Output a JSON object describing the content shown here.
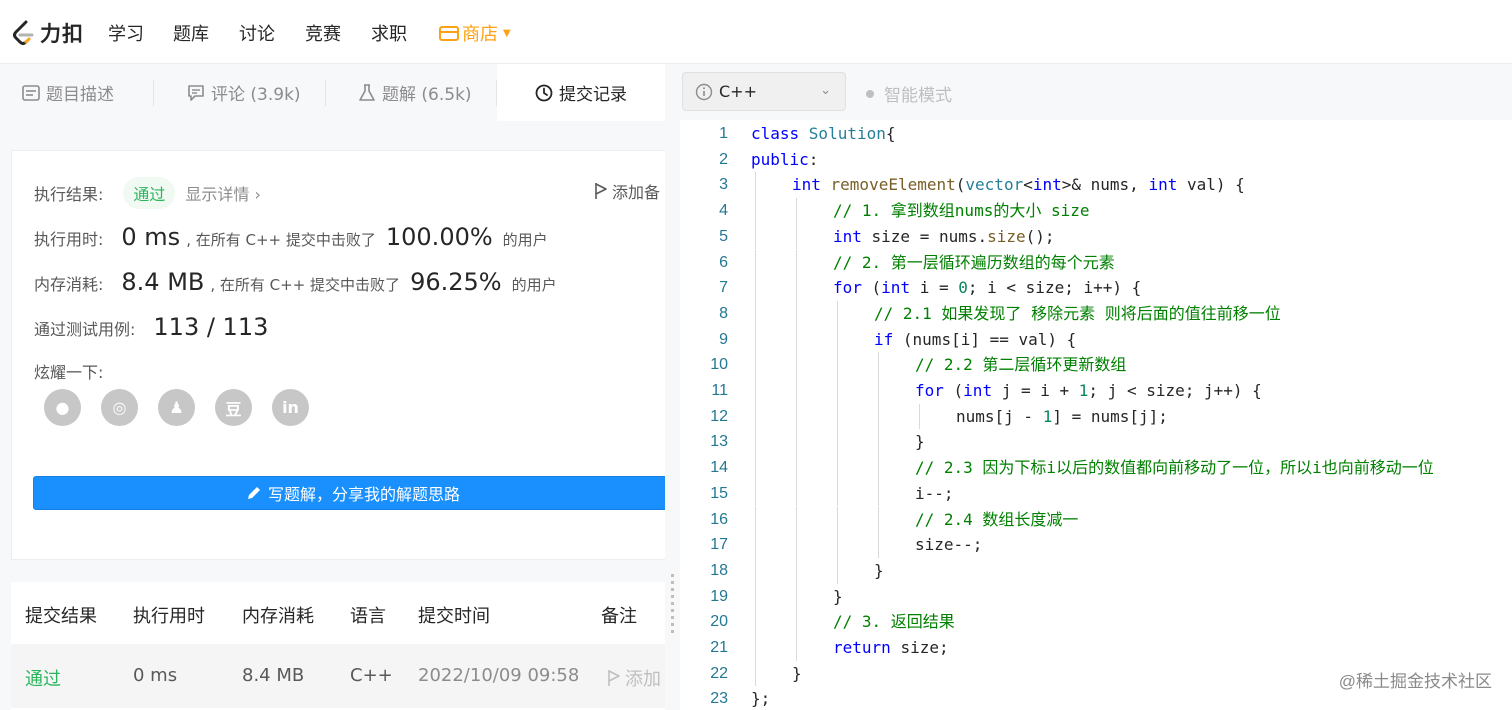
{
  "nav": {
    "logo_text": "力扣",
    "items": [
      "学习",
      "题库",
      "讨论",
      "竞赛",
      "求职"
    ],
    "store_label": "商店",
    "store_color": "#ffa116"
  },
  "tabs": [
    {
      "label": "题目描述",
      "icon": "description-icon"
    },
    {
      "label": "评论 (3.9k)",
      "icon": "comment-icon"
    },
    {
      "label": "题解 (6.5k)",
      "icon": "flask-icon"
    },
    {
      "label": "提交记录",
      "icon": "clock-icon"
    }
  ],
  "result": {
    "status_label": "执行结果:",
    "status_value": "通过",
    "detail_link": "显示详情 ›",
    "add_note": "添加备",
    "runtime_label": "执行用时:",
    "runtime_value": "0 ms",
    "runtime_text": ", 在所有 C++ 提交中击败了",
    "runtime_pct": "100.00%",
    "users_text": "的用户",
    "memory_label": "内存消耗:",
    "memory_value": "8.4 MB",
    "memory_text": ", 在所有 C++ 提交中击败了",
    "memory_pct": "96.25%",
    "testcase_label": "通过测试用例:",
    "testcase_value": "113 / 113",
    "share_label": "炫耀一下:",
    "share_icons": [
      "wechat-icon",
      "weibo-icon",
      "qq-icon",
      "douban-icon",
      "linkedin-icon"
    ],
    "share_glyphs": [
      "●",
      "◎",
      "♟",
      "豆",
      "in"
    ],
    "write_button": "写题解，分享我的解题思路",
    "success_color": "#2db55d",
    "button_color": "#1a90ff"
  },
  "submissions": {
    "headers": [
      "提交结果",
      "执行用时",
      "内存消耗",
      "语言",
      "提交时间",
      "备注"
    ],
    "rows": [
      {
        "result": "通过",
        "runtime": "0 ms",
        "memory": "8.4 MB",
        "lang": "C++",
        "time": "2022/10/09 09:58",
        "note": "添加"
      }
    ]
  },
  "editor": {
    "language": "C++",
    "smart_mode": "智能模式",
    "lines": [
      {
        "n": "1",
        "indent": 0,
        "tokens": [
          [
            "kw",
            "class "
          ],
          [
            "cls",
            "Solution"
          ],
          [
            "",
            "{"
          ]
        ]
      },
      {
        "n": "2",
        "indent": 0,
        "tokens": [
          [
            "kw",
            "public"
          ],
          [
            "",
            ":"
          ]
        ]
      },
      {
        "n": "3",
        "indent": 1,
        "tokens": [
          [
            "ty",
            "int "
          ],
          [
            "fn",
            "removeElement"
          ],
          [
            "",
            "("
          ],
          [
            "cls",
            "vector"
          ],
          [
            "",
            "<"
          ],
          [
            "ty",
            "int"
          ],
          [
            "",
            ">& nums, "
          ],
          [
            "ty",
            "int "
          ],
          [
            "",
            "val) {"
          ]
        ]
      },
      {
        "n": "4",
        "indent": 2,
        "tokens": [
          [
            "cm",
            "// 1. 拿到数组nums的大小 size"
          ]
        ]
      },
      {
        "n": "5",
        "indent": 2,
        "tokens": [
          [
            "ty",
            "int "
          ],
          [
            "",
            "size = nums."
          ],
          [
            "fn",
            "size"
          ],
          [
            "",
            "();"
          ]
        ]
      },
      {
        "n": "6",
        "indent": 2,
        "tokens": [
          [
            "cm",
            "// 2. 第一层循环遍历数组的每个元素"
          ]
        ]
      },
      {
        "n": "7",
        "indent": 2,
        "tokens": [
          [
            "kw",
            "for "
          ],
          [
            "",
            "("
          ],
          [
            "ty",
            "int "
          ],
          [
            "",
            "i = "
          ],
          [
            "num",
            "0"
          ],
          [
            "",
            "; i < size; i++) {"
          ]
        ]
      },
      {
        "n": "8",
        "indent": 3,
        "tokens": [
          [
            "cm",
            "// 2.1 如果发现了 移除元素 则将后面的值往前移一位"
          ]
        ]
      },
      {
        "n": "9",
        "indent": 3,
        "tokens": [
          [
            "kw",
            "if "
          ],
          [
            "",
            "(nums[i] == val) {"
          ]
        ]
      },
      {
        "n": "10",
        "indent": 4,
        "tokens": [
          [
            "cm",
            "// 2.2 第二层循环更新数组"
          ]
        ]
      },
      {
        "n": "11",
        "indent": 4,
        "tokens": [
          [
            "kw",
            "for "
          ],
          [
            "",
            "("
          ],
          [
            "ty",
            "int "
          ],
          [
            "",
            "j = i + "
          ],
          [
            "num",
            "1"
          ],
          [
            "",
            "; j < size; j++) {"
          ]
        ]
      },
      {
        "n": "12",
        "indent": 5,
        "tokens": [
          [
            "",
            "nums[j - "
          ],
          [
            "num",
            "1"
          ],
          [
            "",
            "] = nums[j];"
          ]
        ]
      },
      {
        "n": "13",
        "indent": 4,
        "tokens": [
          [
            "",
            "}"
          ]
        ]
      },
      {
        "n": "14",
        "indent": 4,
        "tokens": [
          [
            "cm",
            "// 2.3 因为下标i以后的数值都向前移动了一位，所以i也向前移动一位"
          ]
        ]
      },
      {
        "n": "15",
        "indent": 4,
        "tokens": [
          [
            "",
            "i--;"
          ]
        ]
      },
      {
        "n": "16",
        "indent": 4,
        "tokens": [
          [
            "cm",
            "// 2.4 数组长度减一"
          ]
        ]
      },
      {
        "n": "17",
        "indent": 4,
        "tokens": [
          [
            "",
            "size--;"
          ]
        ]
      },
      {
        "n": "18",
        "indent": 3,
        "tokens": [
          [
            "",
            "}"
          ]
        ]
      },
      {
        "n": "19",
        "indent": 2,
        "tokens": [
          [
            "",
            "}"
          ]
        ]
      },
      {
        "n": "20",
        "indent": 2,
        "tokens": [
          [
            "cm",
            "// 3. 返回结果"
          ]
        ]
      },
      {
        "n": "21",
        "indent": 2,
        "tokens": [
          [
            "kw",
            "return "
          ],
          [
            "",
            "size;"
          ]
        ]
      },
      {
        "n": "22",
        "indent": 1,
        "tokens": [
          [
            "",
            "}"
          ]
        ]
      },
      {
        "n": "23",
        "indent": 0,
        "tokens": [
          [
            "",
            "};"
          ]
        ]
      }
    ]
  },
  "watermark": "@稀土掘金技术社区"
}
